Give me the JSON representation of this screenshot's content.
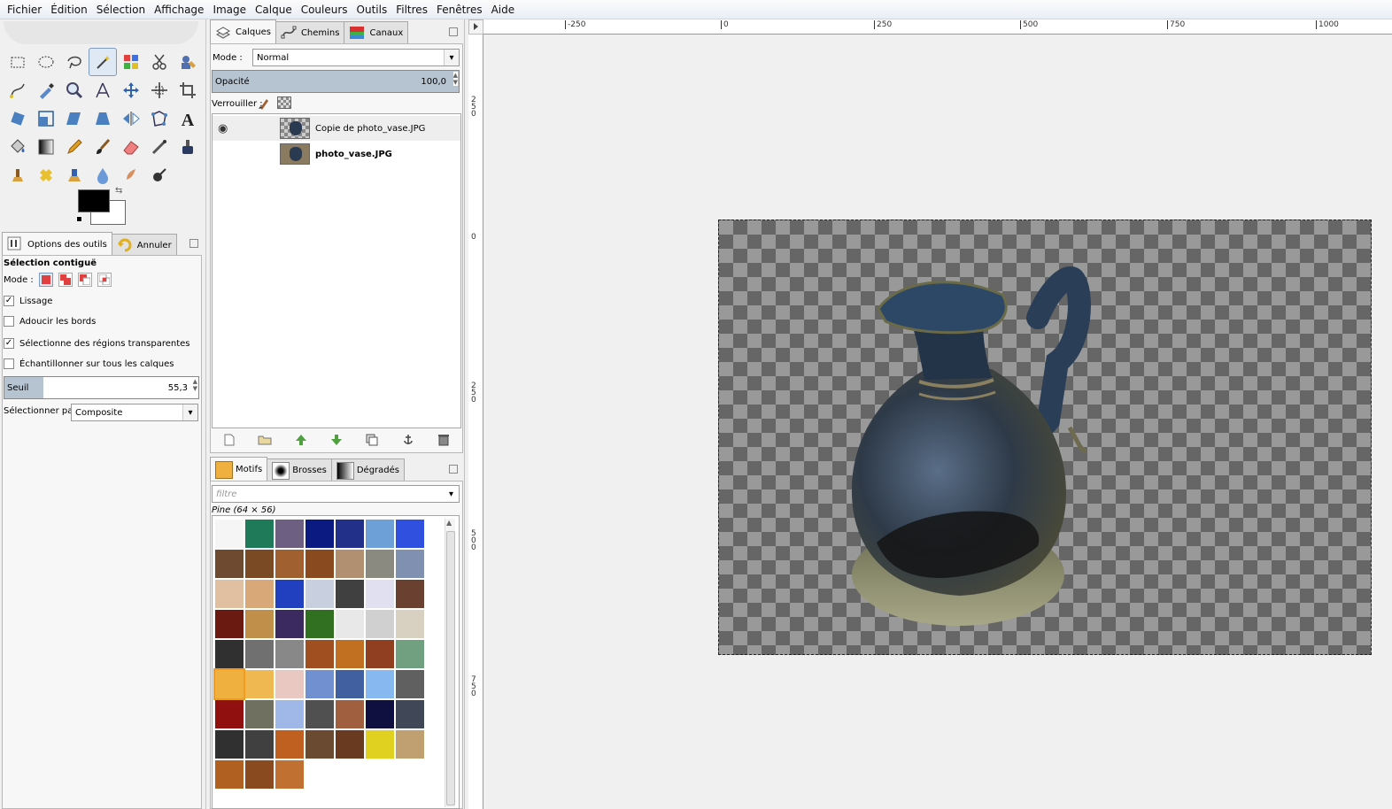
{
  "menu": [
    "Fichier",
    "Édition",
    "Sélection",
    "Affichage",
    "Image",
    "Calque",
    "Couleurs",
    "Outils",
    "Filtres",
    "Fenêtres",
    "Aide"
  ],
  "toolbox": {
    "tools": [
      "rect-select-icon",
      "ellipse-select-icon",
      "lasso-icon",
      "fuzzy-select-icon",
      "select-by-color-icon",
      "scissors-icon",
      "foreground-select-icon",
      "paths-icon",
      "color-picker-icon",
      "zoom-icon",
      "measure-icon",
      "move-icon",
      "align-icon",
      "crop-icon",
      "rotate-icon",
      "scale-icon",
      "shear-icon",
      "perspective-icon",
      "flip-icon",
      "cage-icon",
      "text-icon",
      "bucket-fill-icon",
      "gradient-icon",
      "pencil-icon",
      "paintbrush-icon",
      "eraser-icon",
      "airbrush-icon",
      "ink-icon",
      "clone-icon",
      "heal-icon",
      "perspective-clone-icon",
      "blur-icon",
      "smudge-icon",
      "dodge-burn-icon"
    ],
    "active_tool": "fuzzy-select-icon",
    "fg_color": "#000000",
    "bg_color": "#ffffff",
    "text_tool_glyph": "A"
  },
  "tool_options": {
    "tabs": [
      "Options des outils",
      "Annuler"
    ],
    "title": "Sélection contiguë",
    "mode_label": "Mode :",
    "checks": [
      {
        "label": "Lissage",
        "checked": true
      },
      {
        "label": "Adoucir les bords",
        "checked": false
      },
      {
        "label": "Sélectionne des régions transparentes",
        "checked": true
      },
      {
        "label": "Échantillonner sur tous les calques",
        "checked": false
      }
    ],
    "threshold_label": "Seuil",
    "threshold_value": "55,3",
    "select_by_label": "Sélectionner par :",
    "select_by_value": "Composite"
  },
  "layers": {
    "tabs": [
      "Calques",
      "Chemins",
      "Canaux"
    ],
    "mode_label": "Mode :",
    "mode_value": "Normal",
    "opacity_label": "Opacité",
    "opacity_value": "100,0",
    "lock_label": "Verrouiller :",
    "items": [
      {
        "name": "Copie de photo_vase.JPG",
        "visible": true,
        "selected": true
      },
      {
        "name": "photo_vase.JPG",
        "visible": false,
        "selected": false
      }
    ]
  },
  "patterns": {
    "tabs": [
      "Motifs",
      "Brosses",
      "Dégradés"
    ],
    "filter_placeholder": "filtre",
    "current": "Pine (64 × 56)",
    "colors": [
      "#f5f5f5",
      "#1f7a5a",
      "#6d5f82",
      "#0a1a80",
      "#22308a",
      "#6ea0d8",
      "#3050e0",
      "#6e4a30",
      "#7a4a25",
      "#a06030",
      "#8a4a20",
      "#b09070",
      "#8a8a80",
      "#8090b0",
      "#e0c0a0",
      "#d8a878",
      "#2040c0",
      "#c8d0e0",
      "#404040",
      "#e0e0f0",
      "#6a4030",
      "#6a1a10",
      "#c0904a",
      "#3a2a60",
      "#307020",
      "#e8e8e8",
      "#d0d0d0",
      "#d8d0c0",
      "#303030",
      "#707070",
      "#888888",
      "#a05020",
      "#c07020",
      "#904020",
      "#70a080",
      "#f0b040",
      "#f0b850",
      "#e8c8c0",
      "#7090d0",
      "#4060a0",
      "#88b8f0",
      "#606060",
      "#901010",
      "#707060",
      "#a0b8e8",
      "#505050",
      "#a06040",
      "#101040",
      "#404858",
      "#303030",
      "#404040",
      "#c06020",
      "#6a4a30",
      "#6a3a20",
      "#e0d020",
      "#c0a070",
      "#b06020",
      "#8a4a20",
      "#c07030"
    ],
    "selected_index": 35
  },
  "rulers": {
    "h": [
      "-250",
      "0",
      "250",
      "500",
      "750",
      "1000"
    ],
    "v": [
      "250",
      "0",
      "250",
      "500",
      "750"
    ]
  }
}
